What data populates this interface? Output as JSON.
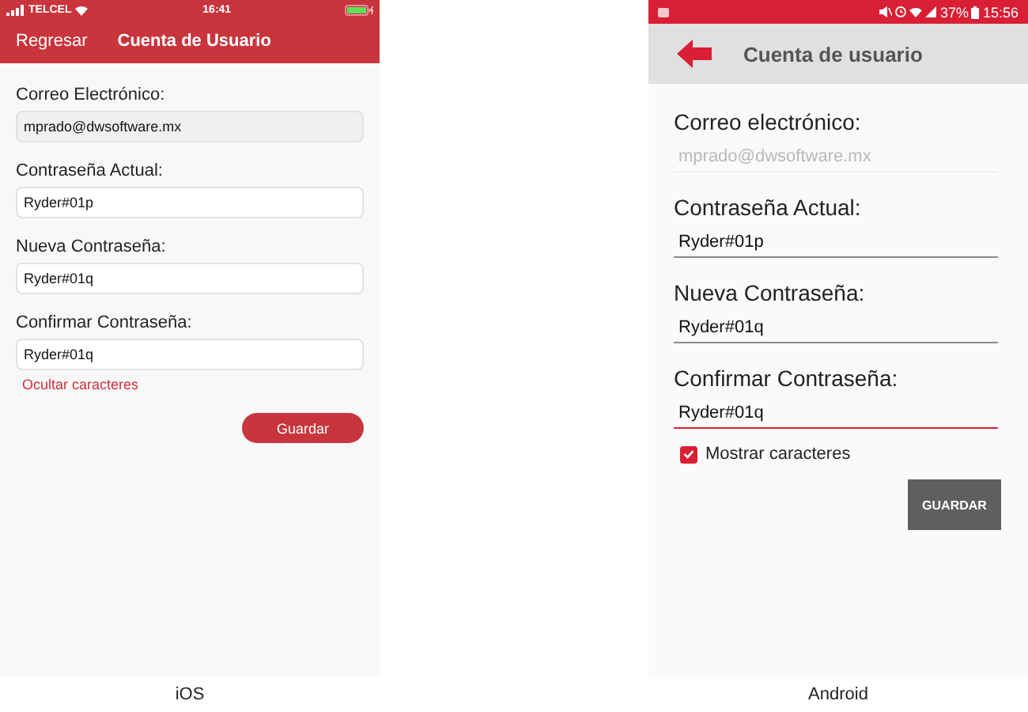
{
  "ios": {
    "caption": "iOS",
    "status_bar": {
      "carrier": "TELCEL",
      "time": "16:41"
    },
    "nav": {
      "back": "Regresar",
      "title": "Cuenta de Usuario"
    },
    "fields": [
      {
        "label": "Correo Electrónico:",
        "value": "mprado@dwsoftware.mx",
        "disabled": true
      },
      {
        "label": "Contraseña Actual:",
        "value": "Ryder#01p",
        "disabled": false
      },
      {
        "label": "Nueva Contraseña:",
        "value": "Ryder#01q",
        "disabled": false
      },
      {
        "label": "Confirmar Contraseña:",
        "value": "Ryder#01q",
        "disabled": false
      }
    ],
    "toggle_link": "Ocultar caracteres",
    "save_button": "Guardar"
  },
  "android": {
    "caption": "Android",
    "status_bar": {
      "battery": "37%",
      "time": "15:56"
    },
    "toolbar": {
      "title": "Cuenta de usuario"
    },
    "fields": [
      {
        "label": "Correo electrónico:",
        "value": "mprado@dwsoftware.mx",
        "disabled": true,
        "focused": false
      },
      {
        "label": "Contraseña Actual:",
        "value": "Ryder#01p",
        "disabled": false,
        "focused": false
      },
      {
        "label": "Nueva Contraseña:",
        "value": "Ryder#01q",
        "disabled": false,
        "focused": false
      },
      {
        "label": "Confirmar Contraseña:",
        "value": "Ryder#01q",
        "disabled": false,
        "focused": true
      }
    ],
    "show_chars": {
      "label": "Mostrar caracteres",
      "checked": true
    },
    "save_button": "GUARDAR"
  }
}
